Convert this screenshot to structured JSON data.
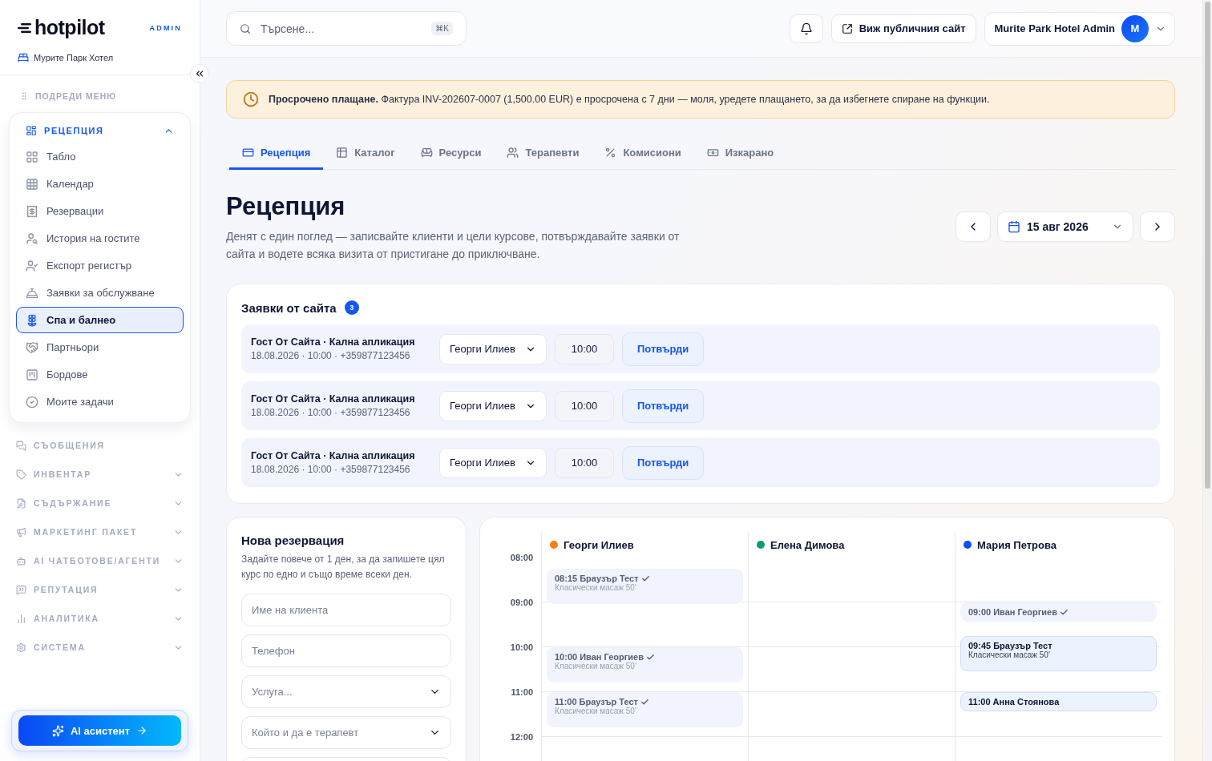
{
  "sidebar": {
    "logo": "hotpilot",
    "badge": "ADMIN",
    "hotel": "Мурите Парк Хотел",
    "reorder": "ПОДРЕДИ МЕНЮ",
    "sections": [
      {
        "label": "РЕЦЕПЦИЯ",
        "kind": "group",
        "expanded": true,
        "items": [
          {
            "label": "Табло",
            "selected": false
          },
          {
            "label": "Календар",
            "selected": false
          },
          {
            "label": "Резервации",
            "selected": false
          },
          {
            "label": "История на гостите",
            "selected": false
          },
          {
            "label": "Експорт регистър",
            "selected": false
          },
          {
            "label": "Заявки за обслужване",
            "selected": false
          },
          {
            "label": "Спа и балнео",
            "selected": true
          },
          {
            "label": "Партньори",
            "selected": false
          },
          {
            "label": "Бордове",
            "selected": false
          },
          {
            "label": "Моите задачи",
            "selected": false
          }
        ]
      },
      {
        "label": "СЪОБЩЕНИЯ",
        "kind": "link",
        "expanded": false
      },
      {
        "label": "ИНВЕНТАР",
        "kind": "group",
        "expanded": false
      },
      {
        "label": "СЪДЪРЖАНИЕ",
        "kind": "group",
        "expanded": false
      },
      {
        "label": "МАРКЕТИНГ ПАКЕТ",
        "kind": "group",
        "expanded": false
      },
      {
        "label": "AI ЧАТБОТОВЕ/АГЕНТИ",
        "kind": "group",
        "expanded": false
      },
      {
        "label": "РЕПУТАЦИЯ",
        "kind": "group",
        "expanded": false
      },
      {
        "label": "АНАЛИТИКА",
        "kind": "group",
        "expanded": false
      },
      {
        "label": "СИСТЕМА",
        "kind": "group",
        "expanded": false
      }
    ],
    "assistant": "AI асистент"
  },
  "topbar": {
    "search": {
      "placeholder": "Търсене...",
      "shortcut": "⌘K"
    },
    "public_site": "Виж публичния сайт",
    "user": "Murite Park Hotel Admin",
    "avatar": "M"
  },
  "alert": {
    "text": "**Просрочено плащане.** Фактура INV-202607-0007 (1,500.00 EUR) е просрочена с 7 дни — моля, уредете плащането, за да избегнете спиране на функции."
  },
  "tabs": [
    {
      "label": "Рецепция",
      "selected": true
    },
    {
      "label": "Каталог",
      "selected": false
    },
    {
      "label": "Ресурси",
      "selected": false
    },
    {
      "label": "Терапевти",
      "selected": false
    },
    {
      "label": "Комисиони",
      "selected": false
    },
    {
      "label": "Изкарано",
      "selected": false
    }
  ],
  "page": {
    "title": "Рецепция",
    "subtitle": "Денят с един поглед — записвайте клиенти и цели курсове, потвърждавайте заявки от сайта и водете всяка визита от пристигане до приключване.",
    "date": "15 авг 2026"
  },
  "requests": {
    "title": "Заявки от сайта",
    "count": "3",
    "rows": [
      {
        "name": "Гост От Сайта · Кална апликация",
        "meta": "18.08.2026 · 10:00 · +359877123456",
        "therapist": "Георги Илиев",
        "time": "10:00",
        "action": "Потвърди"
      },
      {
        "name": "Гост От Сайта · Кална апликация",
        "meta": "18.08.2026 · 10:00 · +359877123456",
        "therapist": "Георги Илиев",
        "time": "10:00",
        "action": "Потвърди"
      },
      {
        "name": "Гост От Сайта · Кална апликация",
        "meta": "18.08.2026 · 10:00 · +359877123456",
        "therapist": "Георги Илиев",
        "time": "10:00",
        "action": "Потвърди"
      }
    ]
  },
  "new_booking": {
    "title": "Нова резервация",
    "description": "Задайте повече от 1 ден, за да запишете цял курс по едно и също време всеки ден.",
    "fields": [
      {
        "kind": "input",
        "placeholder": "Име на клиента"
      },
      {
        "kind": "input",
        "placeholder": "Телефон"
      },
      {
        "kind": "select",
        "placeholder": "Услуга..."
      },
      {
        "kind": "select",
        "placeholder": "Който и да е терапевт"
      },
      {
        "kind": "input"
      }
    ]
  },
  "schedule": {
    "hours": [
      "08:00",
      "09:00",
      "10:00",
      "11:00",
      "12:00"
    ],
    "therapists": [
      {
        "name": "Георги Илиев",
        "color": "#f97f16",
        "events": [
          {
            "time": "08:15",
            "client": "Браузър Тест",
            "service": "Класически масаж 50'",
            "confirmed": true,
            "kind": "full"
          },
          {
            "time": "10:00",
            "client": "Иван Георгиев",
            "service": "Класически масаж 50'",
            "confirmed": true,
            "kind": "full"
          },
          {
            "time": "11:00",
            "client": "Браузър Тест",
            "service": "Класически масаж 50'",
            "confirmed": true,
            "kind": "full"
          }
        ]
      },
      {
        "name": "Елена Димова",
        "color": "#0f9a74"
      },
      {
        "name": "Мария Петрова",
        "color": "#0b4ff5",
        "events": [
          {
            "time": "09:00",
            "client": "Иван Георгиев",
            "confirmed": true,
            "kind": "compact"
          },
          {
            "time": "09:45",
            "client": "Браузър Тест",
            "service": "Класически масаж 50'",
            "confirmed": false,
            "kind": "full"
          },
          {
            "time": "11:00",
            "client": "Анна Стоянова",
            "confirmed": false,
            "kind": "compact"
          }
        ]
      }
    ]
  }
}
